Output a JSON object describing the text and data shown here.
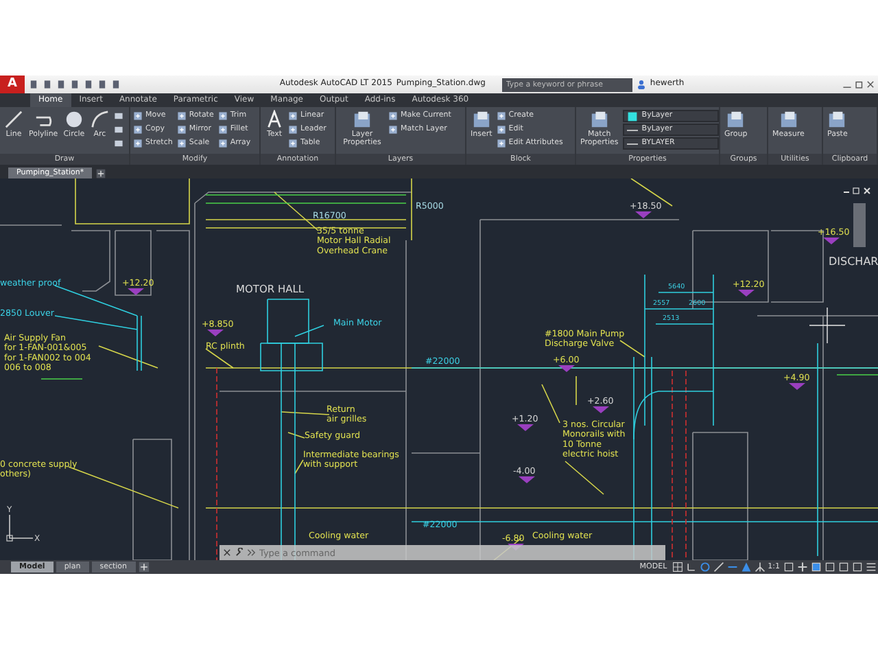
{
  "title_bar": {
    "app_logo": "A",
    "title": "Autodesk AutoCAD LT 2015",
    "file": "Pumping_Station.dwg",
    "search": {
      "placeholder": "Type a keyword or phrase"
    },
    "user": "hewerth"
  },
  "ribbon": {
    "tabs": [
      {
        "label": "Home",
        "selected": true
      },
      {
        "label": "Insert",
        "selected": false
      },
      {
        "label": "Annotate",
        "selected": false
      },
      {
        "label": "Parametric",
        "selected": false
      },
      {
        "label": "View",
        "selected": false
      },
      {
        "label": "Manage",
        "selected": false
      },
      {
        "label": "Output",
        "selected": false
      },
      {
        "label": "Add-ins",
        "selected": false
      },
      {
        "label": "Autodesk 360",
        "selected": false
      }
    ],
    "panels": [
      {
        "title": "Draw",
        "large": [
          "Line",
          "Polyline",
          "Circle",
          "Arc"
        ]
      },
      {
        "title": "Modify",
        "small": [
          "Move",
          "Rotate",
          "Trim",
          "Copy",
          "Mirror",
          "Fillet",
          "Stretch",
          "Scale",
          "Array"
        ]
      },
      {
        "title": "Annotation",
        "large": [
          "Text"
        ],
        "small": [
          "Linear",
          "Leader",
          "Table"
        ]
      },
      {
        "title": "Layers",
        "large": [
          "Layer Properties"
        ],
        "small": [
          "Make Current",
          "Match Layer"
        ]
      },
      {
        "title": "Block",
        "large": [
          "Insert"
        ],
        "small": [
          "Create",
          "Edit",
          "Edit Attributes"
        ]
      },
      {
        "title": "Properties",
        "large": [
          "Match Properties"
        ],
        "dropdowns": [
          "ByLayer",
          "ByLayer",
          "BYLAYER"
        ]
      },
      {
        "title": "Groups",
        "large": [
          "Group"
        ]
      },
      {
        "title": "Utilities",
        "large": [
          "Measure"
        ]
      },
      {
        "title": "Clipboard",
        "large": [
          "Paste"
        ]
      }
    ]
  },
  "document_tabs": [
    {
      "label": "Pumping_Station*",
      "selected": true
    }
  ],
  "drawing": {
    "labels": [
      {
        "kind": "note",
        "color": "#a8dce6",
        "lines": [
          "R16700"
        ]
      },
      {
        "kind": "note",
        "color": "#a8dce6",
        "lines": [
          "R5000"
        ]
      },
      {
        "kind": "note",
        "color": "#e0e050",
        "lines": [
          "35/5 tonne",
          "Motor Hall Radial",
          "Overhead Crane"
        ]
      },
      {
        "kind": "note",
        "color": "#d8d8d8",
        "lines": [
          "MOTOR HALL"
        ]
      },
      {
        "kind": "note",
        "color": "#3cd2e6",
        "lines": [
          "weather proof"
        ]
      },
      {
        "kind": "note",
        "color": "#3cd2e6",
        "lines": [
          "2850 Louver"
        ]
      },
      {
        "kind": "note",
        "color": "#e0e050",
        "lines": [
          "Air Supply Fan",
          "for 1-FAN-001&005",
          "for 1-FAN002 to 004",
          "006 to 008"
        ]
      },
      {
        "kind": "elevation",
        "color": "#e0e050",
        "lines": [
          "+12.20"
        ]
      },
      {
        "kind": "elevation",
        "color": "#e0e050",
        "lines": [
          "+8.850"
        ]
      },
      {
        "kind": "note",
        "color": "#e0e050",
        "lines": [
          "RC plinth"
        ]
      },
      {
        "kind": "note",
        "color": "#3cd2e6",
        "lines": [
          "Main Motor"
        ]
      },
      {
        "kind": "elevation",
        "color": "#d8d8d8",
        "lines": [
          "+18.50"
        ]
      },
      {
        "kind": "elevation",
        "color": "#e0e050",
        "lines": [
          "+16.50"
        ]
      },
      {
        "kind": "note",
        "color": "#d8d8d8",
        "lines": [
          "DISCHAR"
        ]
      },
      {
        "kind": "dimension",
        "color": "#3cd2e6",
        "lines": [
          "5640"
        ]
      },
      {
        "kind": "elevation",
        "color": "#e0e050",
        "lines": [
          "+12.20"
        ]
      },
      {
        "kind": "dimension",
        "color": "#3cd2e6",
        "lines": [
          "2557"
        ]
      },
      {
        "kind": "dimension",
        "color": "#3cd2e6",
        "lines": [
          "2600"
        ]
      },
      {
        "kind": "dimension",
        "color": "#3cd2e6",
        "lines": [
          "2513"
        ]
      },
      {
        "kind": "note",
        "color": "#e0e050",
        "lines": [
          "#1800 Main Pump",
          "Discharge Valve"
        ]
      },
      {
        "kind": "elevation",
        "color": "#e0e050",
        "lines": [
          "+6.00"
        ]
      },
      {
        "kind": "elevation",
        "color": "#e0e050",
        "lines": [
          "+4.90"
        ]
      },
      {
        "kind": "note",
        "color": "#3cd2e6",
        "lines": [
          "#22000"
        ]
      },
      {
        "kind": "elevation",
        "color": "#d8d8d8",
        "lines": [
          "+2.60"
        ]
      },
      {
        "kind": "elevation",
        "color": "#d8d8d8",
        "lines": [
          "+1.20"
        ]
      },
      {
        "kind": "note",
        "color": "#e0e050",
        "lines": [
          "3 nos. Circular",
          "Monorails with",
          "10 Tonne",
          "electric hoist"
        ]
      },
      {
        "kind": "note",
        "color": "#e0e050",
        "lines": [
          "Return",
          "air grilles"
        ]
      },
      {
        "kind": "note",
        "color": "#e0e050",
        "lines": [
          "Safety guard"
        ]
      },
      {
        "kind": "note",
        "color": "#e0e050",
        "lines": [
          "Intermediate bearings",
          "with support"
        ]
      },
      {
        "kind": "note",
        "color": "#e0e050",
        "lines": [
          "0 concrete supply",
          "others)"
        ]
      },
      {
        "kind": "elevation",
        "color": "#d8d8d8",
        "lines": [
          "-4.00"
        ]
      },
      {
        "kind": "note",
        "color": "#3cd2e6",
        "lines": [
          "#22000"
        ]
      },
      {
        "kind": "note",
        "color": "#e0e050",
        "lines": [
          "Cooling water"
        ]
      },
      {
        "kind": "elevation",
        "color": "#e0e050",
        "lines": [
          "-6.80"
        ]
      },
      {
        "kind": "note",
        "color": "#e0e050",
        "lines": [
          "Cooling water"
        ]
      }
    ]
  },
  "ucs": {
    "x": "X",
    "y": "Y"
  },
  "command_line": {
    "placeholder": "Type a command"
  },
  "layout_tabs": [
    {
      "label": "Model",
      "selected": true
    },
    {
      "label": "plan",
      "selected": false
    },
    {
      "label": "section",
      "selected": false
    }
  ],
  "status_bar": {
    "space": "MODEL",
    "scale": "1:1"
  }
}
